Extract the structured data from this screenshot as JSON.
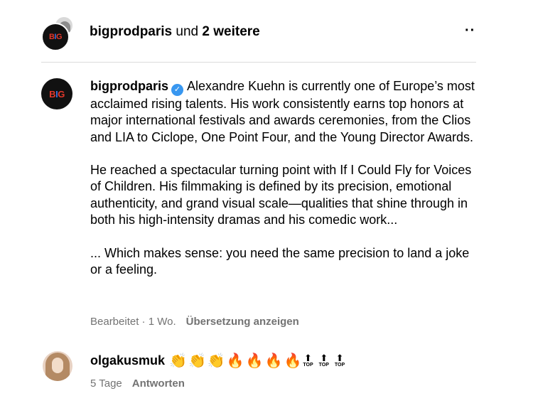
{
  "header": {
    "username": "bigprodparis",
    "connector": " und ",
    "others": "2 weitere",
    "more_label": "··"
  },
  "logo": {
    "b": "B",
    "i": "I",
    "g": "G"
  },
  "post": {
    "author": "bigprodparis",
    "verified_icon": "✓",
    "paragraph_1": "Alexandre Kuehn is currently one of Europe’s most acclaimed rising talents. His work consistently earns top honors at major international festivals and awards ceremonies, from the Clios and LIA to Ciclope, One Point Four, and the Young Director Awards.",
    "paragraph_2": "He reached a spectacular turning point with If I Could Fly for Voices of Children. His filmmaking is defined by its precision, emotional authenticity, and grand visual scale—qualities that shine through in both his high-intensity dramas and his comedic work...",
    "paragraph_3": "... Which makes sense: you need the same precision to land a joke or a feeling.",
    "meta_time": "Bearbeitet · 1 Wo.",
    "translate_label": "Übersetzung anzeigen"
  },
  "comment": {
    "username": "olgakusmuk",
    "emojis": {
      "clap_1": "👏",
      "clap_2": "👏",
      "clap_3": "👏",
      "fire_1": "🔥",
      "fire_2": "🔥",
      "fire_3": "🔥",
      "fire_4": "🔥",
      "top_arrow": "⬆",
      "top_label": "TOP"
    },
    "time": "5 Tage",
    "reply_label": "Antworten"
  },
  "colors": {
    "accent": "#3897f0",
    "muted": "#737373",
    "logo_red": "#e2372b",
    "logo_blue": "#3b6fd9"
  }
}
